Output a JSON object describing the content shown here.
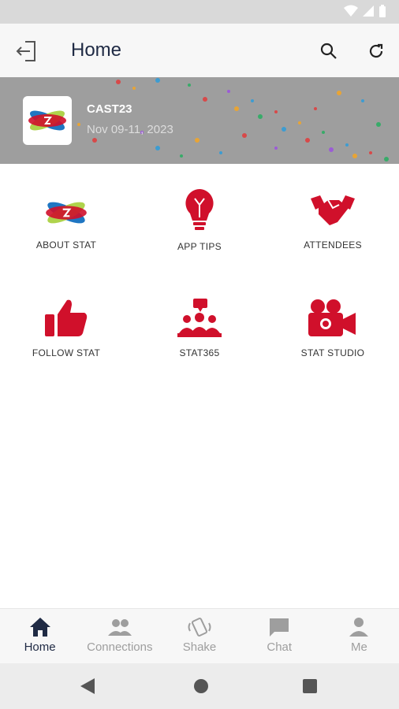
{
  "header": {
    "title": "Home"
  },
  "banner": {
    "event_name": "CAST23",
    "event_dates": "Nov 09-11, 2023"
  },
  "tiles": [
    {
      "label": "ABOUT STAT",
      "icon": "stat-logo-icon"
    },
    {
      "label": "APP TIPS",
      "icon": "lightbulb-icon"
    },
    {
      "label": "ATTENDEES",
      "icon": "handshake-icon"
    },
    {
      "label": "FOLLOW STAT",
      "icon": "thumbs-up-icon"
    },
    {
      "label": "STAT365",
      "icon": "group-presentation-icon"
    },
    {
      "label": "STAT STUDIO",
      "icon": "video-camera-icon"
    }
  ],
  "bottom_nav": [
    {
      "label": "Home",
      "icon": "home-icon",
      "active": true
    },
    {
      "label": "Connections",
      "icon": "people-icon",
      "active": false
    },
    {
      "label": "Shake",
      "icon": "shake-icon",
      "active": false
    },
    {
      "label": "Chat",
      "icon": "chat-icon",
      "active": false
    },
    {
      "label": "Me",
      "icon": "person-icon",
      "active": false
    }
  ],
  "colors": {
    "accent_red": "#d0102b",
    "nav_active": "#1f2a44",
    "nav_inactive": "#9e9e9e"
  }
}
